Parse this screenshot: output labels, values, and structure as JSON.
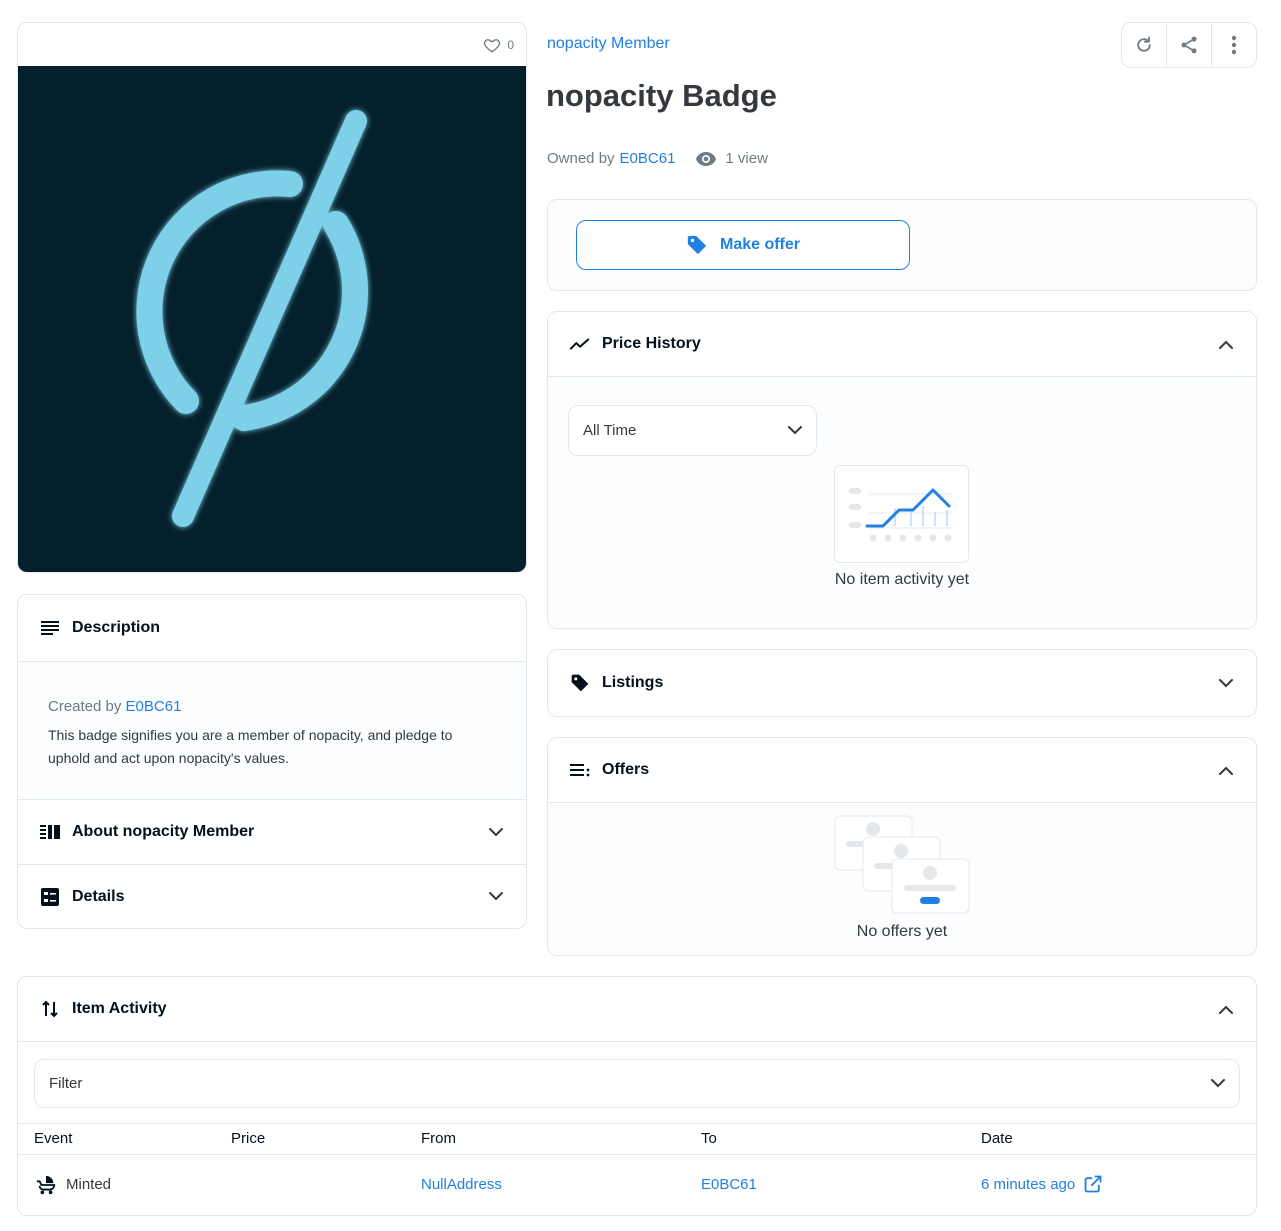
{
  "like": {
    "count": "0"
  },
  "collection": {
    "name": "nopacity Member"
  },
  "item": {
    "title": "nopacity Badge"
  },
  "owner": {
    "prefix": "Owned by",
    "name": "E0BC61",
    "views": "1 view"
  },
  "actions": {
    "make_offer": "Make offer"
  },
  "price_history": {
    "title": "Price History",
    "range_selected": "All Time",
    "empty": "No item activity yet"
  },
  "listings": {
    "title": "Listings"
  },
  "offers": {
    "title": "Offers",
    "empty": "No offers yet"
  },
  "description": {
    "title": "Description",
    "created_by_prefix": "Created by",
    "creator": "E0BC61",
    "text": "This badge signifies you are a member of nopacity, and pledge to uphold and act upon nopacity's values."
  },
  "about": {
    "title": "About nopacity Member"
  },
  "details": {
    "title": "Details"
  },
  "activity": {
    "title": "Item Activity",
    "filter_placeholder": "Filter",
    "columns": {
      "event": "Event",
      "price": "Price",
      "from": "From",
      "to": "To",
      "date": "Date"
    },
    "rows": [
      {
        "event": "Minted",
        "price": "",
        "from": "NullAddress",
        "to": "E0BC61",
        "date": "6 minutes ago"
      }
    ]
  },
  "colors": {
    "accent": "#2081e2",
    "image_bg": "#04202c",
    "logo": "#7ecfe8"
  },
  "icons": [
    "heart-icon",
    "refresh-icon",
    "share-icon",
    "more-icon",
    "eye-icon",
    "tag-icon",
    "trending-icon",
    "chevron-up-icon",
    "chevron-down-icon",
    "list-icon",
    "details-icon",
    "swap-icon",
    "stroller-icon",
    "external-link-icon"
  ]
}
